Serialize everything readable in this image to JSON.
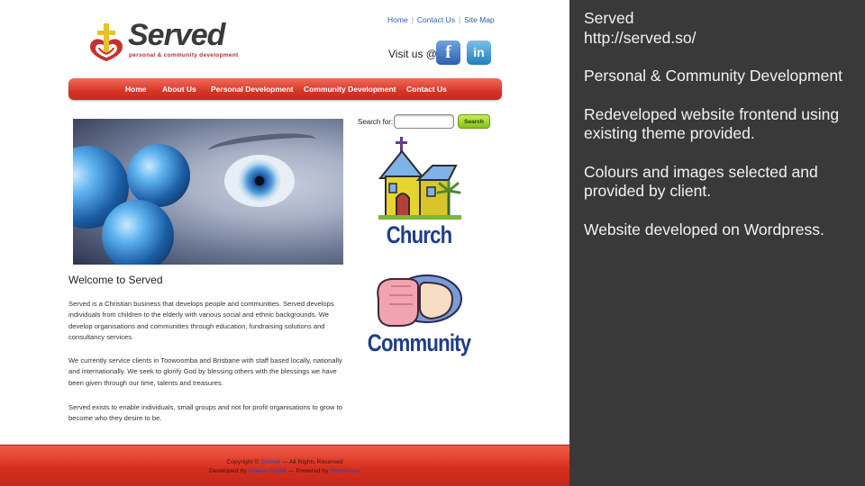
{
  "site": {
    "logo": {
      "name": "Served",
      "tagline": "personal & community development"
    },
    "top_links": [
      "Home",
      "Contact Us",
      "Site Map"
    ],
    "visit_label": "Visit us @",
    "social": {
      "facebook_glyph": "f",
      "linkedin_glyph": "in"
    },
    "nav": [
      "Home",
      "About Us",
      "Personal Development",
      "Community Development",
      "Contact Us"
    ],
    "welcome_title": "Welcome to Served",
    "paragraphs": [
      "Served is a Christian business that develops people and communities. Served develops individuals from children to the elderly with various social and ethnic backgrounds. We develop organisations and communities through education, fundraising solutions and consultancy services.",
      "We currently service clients in Toowoomba and Brisbane with staff based locally, nationally and internationally. We seek to glorify God by blessing others with the blessings we have been given through our time, talents and treasures.",
      "Served exists to enable individuals, small groups and not for profit organisations to grow to become who they desire to be."
    ],
    "search": {
      "label": "Search for:",
      "value": "",
      "button": "Search"
    },
    "church_label": "Church",
    "community_label": "Community",
    "footer": {
      "copyright_prefix": "Copyright ©",
      "copyright_link": "Served",
      "copyright_suffix": "— All Rights Reserved",
      "developed_prefix": "Developed by",
      "developed_link": "Kinesis Digital",
      "powered_prefix": "— Powered by",
      "powered_link": "WordPress"
    },
    "colors": {
      "nav_red": "#d63526",
      "footer_red": "#e0402e",
      "link_blue": "#2a5db0",
      "search_green": "#84c11c",
      "label_blue": "#1f3d8a"
    }
  },
  "panel": {
    "lines": [
      "Served",
      "http://served.so/",
      "",
      "Personal & Community Development",
      "",
      "Redeveloped website frontend using",
      "existing theme provided.",
      "",
      "Colours and images selected and",
      "provided by client.",
      "",
      "Website developed on Wordpress."
    ],
    "background": "#393939"
  }
}
